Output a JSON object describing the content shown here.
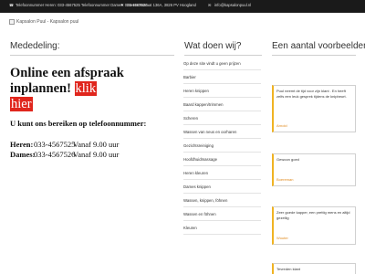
{
  "topbar": {
    "phones": "Telefoonnummer Heren: 033-4567525 Telefoonnummer Dames: 033-4567526",
    "address": "Dorentosstraat 136A, 3826 PV Hoogland",
    "email": "info@kapsalonpuul.nl"
  },
  "logo": {
    "alt": "Kapsalon Puul - Kapsalon puul"
  },
  "main": {
    "title": "Mededeling:",
    "headline": "Online een afspraak inplannen!",
    "klik": "klik",
    "hier": "hier",
    "reach": "U kunt ons bereiken op telefoonnummer:",
    "heren_label": "Heren:",
    "heren_number": "033-4567525",
    "heren_vanaf": "Vanaf 9.00 uur",
    "dames_label": "Dames:",
    "dames_number": "033-4567526",
    "dames_vanaf": "Vanaf 9.00 uur"
  },
  "services": {
    "title": "Wat doen wij?",
    "items": [
      "Op deze site vindt u geen prijzen",
      "Barbier",
      "Heren knippen",
      "Baard kappen/trimmen",
      "Scheren",
      "Wassen van neus en oorharen",
      "Gezichtsreiniging",
      "Hoofdhuidmassage",
      "Heren kleuren",
      "Dames knippen",
      "Wassen, knippen, föhnen",
      "Wassen en föhnen",
      "Kleuren"
    ]
  },
  "reviews": {
    "title": "Een aantal voorbeelden",
    "items": [
      {
        "text": "Puul neemt de tijd voor zijn klant . En heeft zelfs een leuk gesprek tijdens de knipbeurt.",
        "name": "Arnold"
      },
      {
        "text": "Gewoon goed",
        "name": "Boereman"
      },
      {
        "text": "Zeer goede kapper, een prettig mens en altijd gezellig",
        "name": "Wouter"
      },
      {
        "text": "Tevreden klant",
        "name": ""
      }
    ]
  }
}
